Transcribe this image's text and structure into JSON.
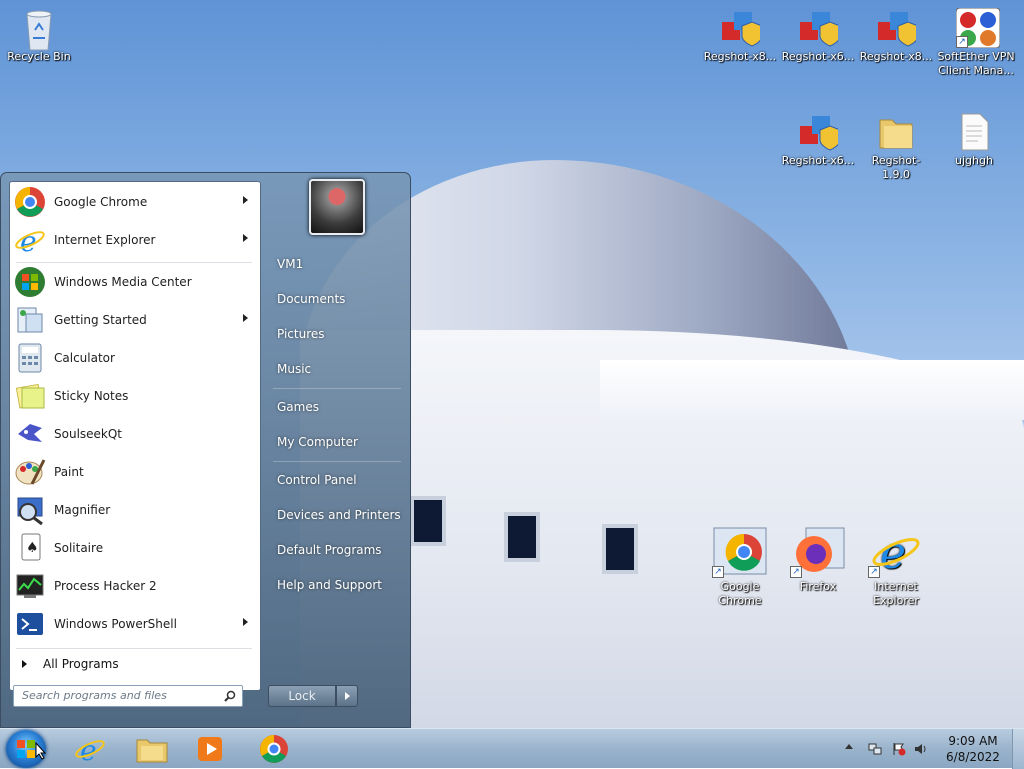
{
  "desktop": {
    "icons": [
      {
        "label": "Recycle Bin"
      },
      {
        "label": "Regshot-x8..."
      },
      {
        "label": "Regshot-x6..."
      },
      {
        "label": "Regshot-x8..."
      },
      {
        "label": "SoftEther VPN Client Mana..."
      },
      {
        "label": "Regshot-x6..."
      },
      {
        "label": "Regshot-1.9.0"
      },
      {
        "label": "ujghgh"
      },
      {
        "label": "Google Chrome"
      },
      {
        "label": "Firefox"
      },
      {
        "label": "Internet Explorer"
      }
    ]
  },
  "start_menu": {
    "programs": [
      {
        "label": "Google Chrome",
        "icon": "chrome-icon"
      },
      {
        "label": "Internet Explorer",
        "icon": "internet-explorer-icon"
      },
      {
        "label": "Windows Media Center",
        "icon": "media-center-icon"
      },
      {
        "label": "Getting Started",
        "icon": "getting-started-icon"
      },
      {
        "label": "Calculator",
        "icon": "calculator-icon"
      },
      {
        "label": "Sticky Notes",
        "icon": "sticky-notes-icon"
      },
      {
        "label": "SoulseekQt",
        "icon": "soulseek-icon"
      },
      {
        "label": "Paint",
        "icon": "paint-icon"
      },
      {
        "label": "Magnifier",
        "icon": "magnifier-icon"
      },
      {
        "label": "Solitaire",
        "icon": "solitaire-icon"
      },
      {
        "label": "Process Hacker 2",
        "icon": "process-hacker-icon"
      },
      {
        "label": "Windows PowerShell",
        "icon": "powershell-icon"
      }
    ],
    "all_programs": "All Programs",
    "search_placeholder": "Search programs and files",
    "right_items": [
      {
        "label": "VM1"
      },
      {
        "label": "Documents"
      },
      {
        "label": "Pictures"
      },
      {
        "label": "Music"
      },
      {
        "label": "Games"
      },
      {
        "label": "My Computer"
      },
      {
        "label": "Control Panel"
      },
      {
        "label": "Devices and Printers"
      },
      {
        "label": "Default Programs"
      },
      {
        "label": "Help and Support"
      }
    ],
    "lock_label": "Lock"
  },
  "taskbar": {
    "time": "9:09 AM",
    "date": "6/8/2022"
  }
}
